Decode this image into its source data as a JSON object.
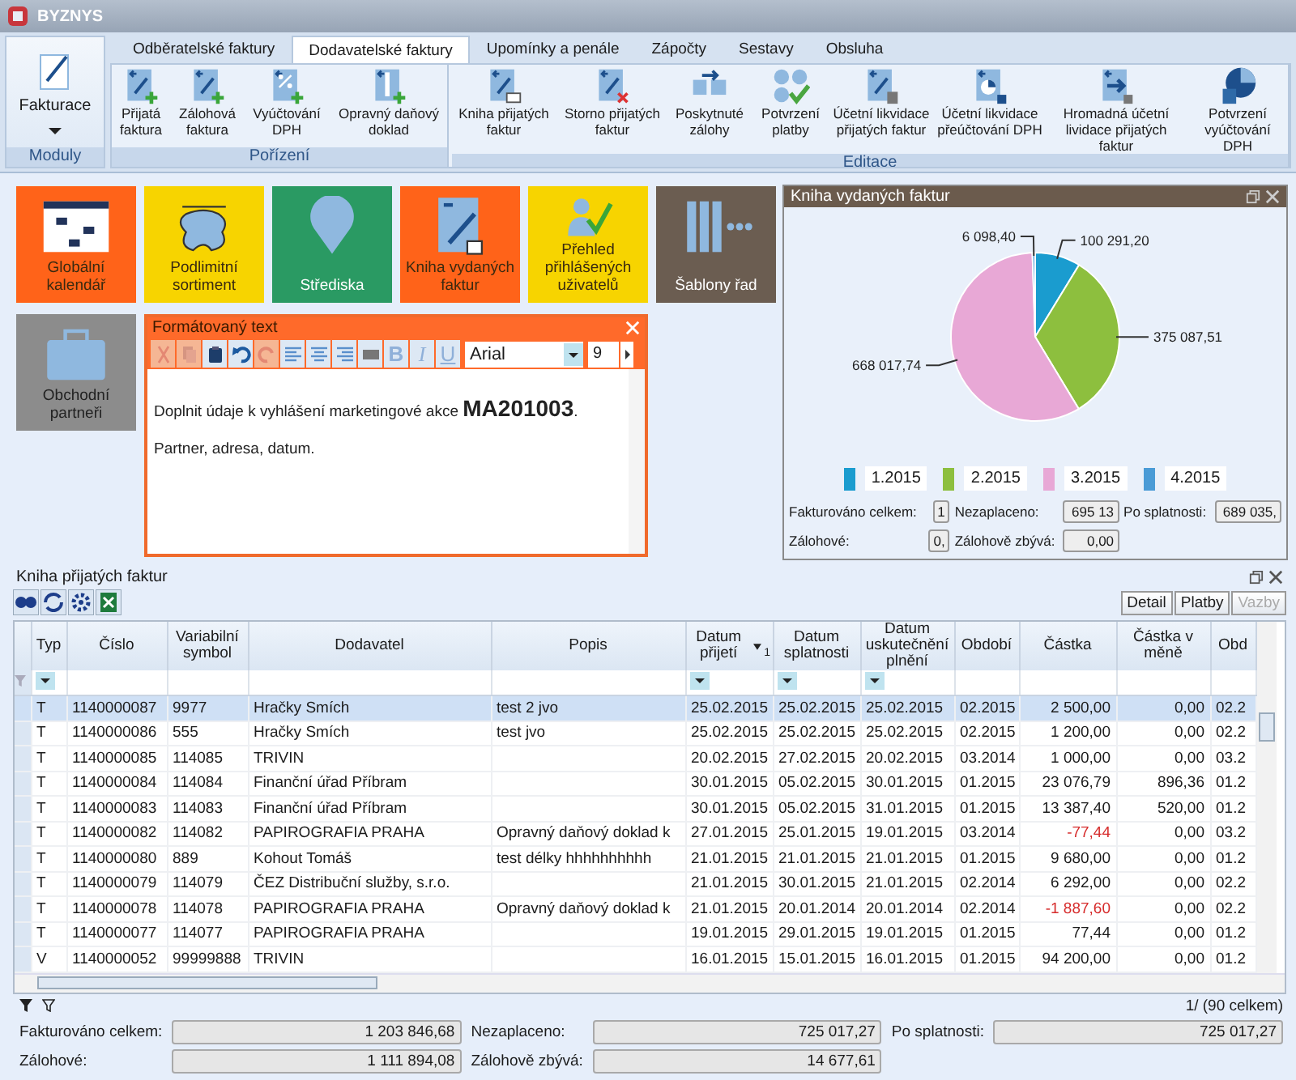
{
  "window": {
    "title": "BYZNYS"
  },
  "ribbon": {
    "module": {
      "label": "Fakturace",
      "group": "Moduly"
    },
    "tabs": [
      {
        "label": "Odběratelské faktury",
        "selected": false
      },
      {
        "label": "Dodavatelské faktury",
        "selected": true
      },
      {
        "label": "Upomínky a penále",
        "selected": false
      },
      {
        "label": "Zápočty",
        "selected": false
      },
      {
        "label": "Sestavy",
        "selected": false
      },
      {
        "label": "Obsluha",
        "selected": false
      }
    ],
    "groups": [
      {
        "label": "Pořízení",
        "buttons": [
          "Přijatá faktura",
          "Zálohová faktura",
          "Vyúčtování DPH",
          "Opravný daňový doklad"
        ]
      },
      {
        "label": "Editace",
        "buttons": [
          "Kniha přijatých faktur",
          "Storno přijatých faktur",
          "Poskytnuté zálohy",
          "Potvrzení platby",
          "Účetní likvidace přijatých faktur",
          "Účetní likvidace přeúčtování DPH",
          "Hromadná účetní lividace přijatých faktur",
          "Potvrzení vyúčtování DPH"
        ]
      }
    ]
  },
  "tiles": [
    {
      "label": "Globální kalendář",
      "color": "#ff6319"
    },
    {
      "label": "Podlimitní sortiment",
      "color": "#f7d400"
    },
    {
      "label": "Střediska",
      "color": "#2a9a63"
    },
    {
      "label": "Kniha vydaných faktur",
      "color": "#ff6319"
    },
    {
      "label": "Přehled přihlášených uživatelů",
      "color": "#f7d400"
    },
    {
      "label": "Šablony řad",
      "color": "#6b5d51"
    },
    {
      "label": "Obchodní partneři",
      "color": "#8c8c8c"
    }
  ],
  "editor": {
    "title": "Formátovaný text",
    "tools": [
      {
        "disabled": true
      },
      {
        "disabled": true
      },
      {
        "disabled": false
      },
      {
        "disabled": false
      },
      {
        "disabled": true
      },
      {
        "disabled": false
      },
      {
        "disabled": false
      },
      {
        "disabled": false
      },
      {
        "disabled": false
      }
    ],
    "styles": [
      "B",
      "I",
      "U"
    ],
    "font": "Arial",
    "size": "9",
    "paragraphs": [
      "Doplnit údaje k vyhlášení marketingové akce **MA201003**.",
      "Partner, adresa, datum."
    ]
  },
  "chart_panel": {
    "title": "Kniha vydaných faktur",
    "chart_data": {
      "type": "pie",
      "categories": [
        "1.2015",
        "2.2015",
        "3.2015",
        "4.2015"
      ],
      "values": [
        100291.2,
        375087.51,
        668017.74,
        6098.4
      ],
      "value_labels": [
        "100 291,20",
        "375 087,51",
        "668 017,74",
        "6 098,40"
      ],
      "legend": "bottom"
    },
    "slices": [
      {
        "color": "#1a9ccf"
      },
      {
        "color": "#8dbf3e"
      },
      {
        "color": "#e8a8d6"
      },
      {
        "color": "#4a9bd6"
      }
    ],
    "stats": [
      {
        "label": "Fakturováno celkem:",
        "value": "1"
      },
      {
        "label": "Nezaplaceno:",
        "value": "695 13"
      },
      {
        "label": "Po splatnosti:",
        "value": "689 035,"
      },
      {
        "label": "Zálohové:",
        "value": "0,"
      },
      {
        "label": "Zálohově zbývá:",
        "value": "0,00"
      }
    ]
  },
  "table": {
    "title": "Kniha přijatých faktur",
    "buttons": [
      {
        "label": "Detail",
        "disabled": false
      },
      {
        "label": "Platby",
        "disabled": false
      },
      {
        "label": "Vazby",
        "disabled": true
      }
    ],
    "columns": [
      {
        "label": "Typ",
        "filter": true,
        "sorted": false
      },
      {
        "label": "Číslo",
        "filter": false,
        "sorted": false
      },
      {
        "label": "Variabilní symbol",
        "filter": false,
        "sorted": false
      },
      {
        "label": "Dodavatel",
        "filter": false,
        "sorted": false
      },
      {
        "label": "Popis",
        "filter": false,
        "sorted": false
      },
      {
        "label": "Datum přijetí",
        "filter": true,
        "sorted": true,
        "sort_order": "1"
      },
      {
        "label": "Datum splatnosti",
        "filter": true,
        "sorted": false
      },
      {
        "label": "Datum uskutečnění plnění",
        "filter": true,
        "sorted": false
      },
      {
        "label": "Období",
        "filter": false,
        "sorted": false
      },
      {
        "label": "Částka",
        "filter": false,
        "sorted": false
      },
      {
        "label": "Částka v měně",
        "filter": false,
        "sorted": false
      },
      {
        "label": "Obd",
        "filter": false,
        "sorted": false
      }
    ],
    "rows": [
      {
        "typ": "T",
        "cislo": "1140000087",
        "vs": "9977",
        "dodavatel": "Hračky Smích",
        "popis": "test 2 jvo",
        "prijeti": "25.02.2015",
        "splatnost": "25.02.2015",
        "plneni": "25.02.2015",
        "obdobi": "02.2015",
        "castka": "2 500,00",
        "mena": "0,00",
        "obd": "02.2",
        "negative": false,
        "selected": true
      },
      {
        "typ": "T",
        "cislo": "1140000086",
        "vs": "555",
        "dodavatel": "Hračky Smích",
        "popis": "test jvo",
        "prijeti": "25.02.2015",
        "splatnost": "25.02.2015",
        "plneni": "25.02.2015",
        "obdobi": "02.2015",
        "castka": "1 200,00",
        "mena": "0,00",
        "obd": "02.2",
        "negative": false,
        "selected": false
      },
      {
        "typ": "T",
        "cislo": "1140000085",
        "vs": "114085",
        "dodavatel": "TRIVIN",
        "prijeti": "20.02.2015",
        "splatnost": "27.02.2015",
        "plneni": "20.02.2015",
        "obdobi": "03.2014",
        "castka": "1 000,00",
        "mena": "0,00",
        "obd": "03.2",
        "negative": false,
        "selected": false
      },
      {
        "typ": "T",
        "cislo": "1140000084",
        "vs": "114084",
        "dodavatel": "Finanční úřad Příbram",
        "prijeti": "30.01.2015",
        "splatnost": "05.02.2015",
        "plneni": "30.01.2015",
        "obdobi": "01.2015",
        "castka": "23 076,79",
        "mena": "896,36",
        "obd": "01.2",
        "negative": false,
        "selected": false
      },
      {
        "typ": "T",
        "cislo": "1140000083",
        "vs": "114083",
        "dodavatel": "Finanční úřad Příbram",
        "prijeti": "30.01.2015",
        "splatnost": "05.02.2015",
        "plneni": "31.01.2015",
        "obdobi": "01.2015",
        "castka": "13 387,40",
        "mena": "520,00",
        "obd": "01.2",
        "negative": false,
        "selected": false
      },
      {
        "typ": "T",
        "cislo": "1140000082",
        "vs": "114082",
        "dodavatel": "PAPIROGRAFIA PRAHA",
        "popis": "Opravný daňový doklad k",
        "prijeti": "27.01.2015",
        "splatnost": "25.01.2015",
        "plneni": "19.01.2015",
        "obdobi": "03.2014",
        "castka": "-77,44",
        "mena": "0,00",
        "obd": "03.2",
        "negative": true,
        "selected": false
      },
      {
        "typ": "T",
        "cislo": "1140000080",
        "vs": "889",
        "dodavatel": "Kohout Tomáš",
        "popis": "test délky hhhhhhhhhh",
        "prijeti": "21.01.2015",
        "splatnost": "21.01.2015",
        "plneni": "21.01.2015",
        "obdobi": "01.2015",
        "castka": "9 680,00",
        "mena": "0,00",
        "obd": "01.2",
        "negative": false,
        "selected": false
      },
      {
        "typ": "T",
        "cislo": "1140000079",
        "vs": "114079",
        "dodavatel": "ČEZ Distribuční služby, s.r.o.",
        "prijeti": "21.01.2015",
        "splatnost": "30.01.2015",
        "plneni": "21.01.2015",
        "obdobi": "02.2014",
        "castka": "6 292,00",
        "mena": "0,00",
        "obd": "02.2",
        "negative": false,
        "selected": false
      },
      {
        "typ": "T",
        "cislo": "1140000078",
        "vs": "114078",
        "dodavatel": "PAPIROGRAFIA PRAHA",
        "popis": "Opravný daňový doklad k",
        "prijeti": "21.01.2015",
        "splatnost": "20.01.2014",
        "plneni": "20.01.2014",
        "obdobi": "02.2014",
        "castka": "-1 887,60",
        "mena": "0,00",
        "obd": "02.2",
        "negative": true,
        "selected": false
      },
      {
        "typ": "T",
        "cislo": "1140000077",
        "vs": "114077",
        "dodavatel": "PAPIROGRAFIA PRAHA",
        "prijeti": "19.01.2015",
        "splatnost": "29.01.2015",
        "plneni": "19.01.2015",
        "obdobi": "01.2015",
        "castka": "77,44",
        "mena": "0,00",
        "obd": "01.2",
        "negative": false,
        "selected": false
      },
      {
        "typ": "V",
        "cislo": "1140000052",
        "vs": "99999888",
        "dodavatel": "TRIVIN",
        "prijeti": "16.01.2015",
        "splatnost": "15.01.2015",
        "plneni": "16.01.2015",
        "obdobi": "01.2015",
        "castka": "94 200,00",
        "mena": "0,00",
        "obd": "01.2",
        "negative": false,
        "selected": false
      }
    ],
    "record_count": "1/ (90 celkem)",
    "summary": [
      {
        "label": "Fakturováno celkem:",
        "value": "1 203 846,68"
      },
      {
        "label": "Nezaplaceno:",
        "value": "725 017,27"
      },
      {
        "label": "Po splatnosti:",
        "value": "725 017,27"
      },
      {
        "label": "Zálohové:",
        "value": "1 111 894,08"
      },
      {
        "label": "Zálohově zbývá:",
        "value": "14 677,61"
      }
    ]
  }
}
